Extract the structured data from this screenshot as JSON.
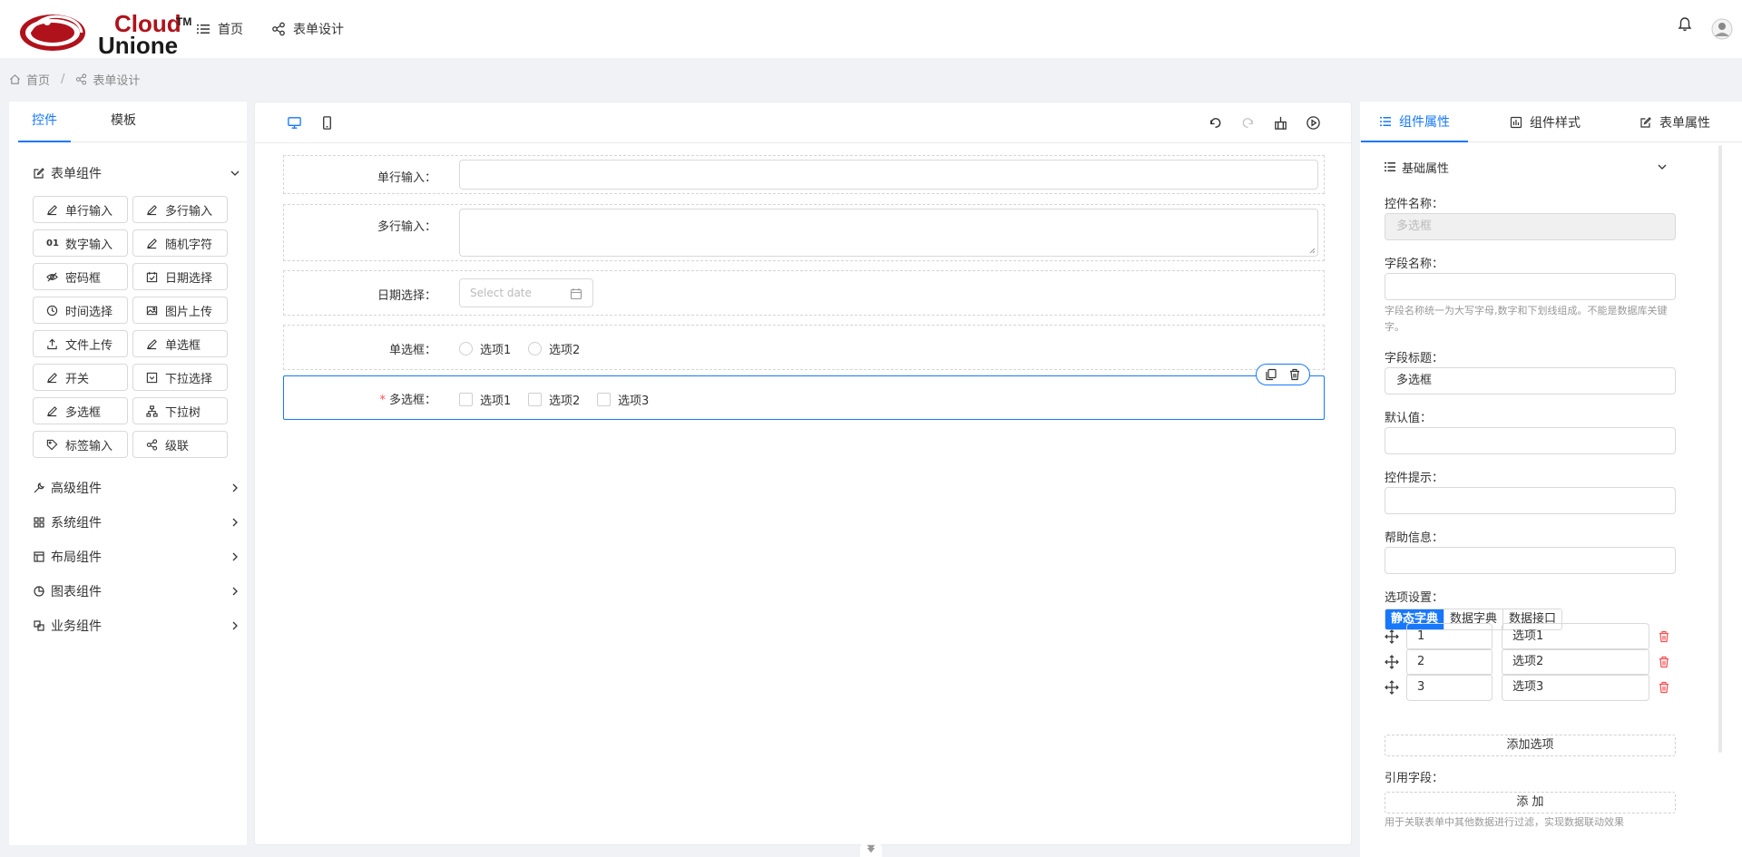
{
  "brand": {
    "line1": "Cloud",
    "line2": "Unione",
    "tm": "TM",
    "primary_color": "#b0121b"
  },
  "nav": {
    "home": "首页",
    "form_design": "表单设计"
  },
  "breadcrumb": {
    "home": "首页",
    "separator": "/",
    "current": "表单设计"
  },
  "left_panel": {
    "tabs": [
      "控件",
      "模板"
    ],
    "active_tab": "控件",
    "form_group": "表单组件",
    "components": [
      {
        "label": "单行输入",
        "icon": "pen-icon"
      },
      {
        "label": "多行输入",
        "icon": "pen-icon"
      },
      {
        "label": "数字输入",
        "icon": "number-icon",
        "glyph": "01"
      },
      {
        "label": "随机字符",
        "icon": "pen-icon"
      },
      {
        "label": "密码框",
        "icon": "eye-off-icon"
      },
      {
        "label": "日期选择",
        "icon": "calendar-check-icon"
      },
      {
        "label": "时间选择",
        "icon": "clock-icon"
      },
      {
        "label": "图片上传",
        "icon": "image-icon"
      },
      {
        "label": "文件上传",
        "icon": "upload-icon"
      },
      {
        "label": "单选框",
        "icon": "pen-icon"
      },
      {
        "label": "开关",
        "icon": "pen-icon"
      },
      {
        "label": "下拉选择",
        "icon": "select-icon"
      },
      {
        "label": "多选框",
        "icon": "pen-icon"
      },
      {
        "label": "下拉树",
        "icon": "tree-icon"
      },
      {
        "label": "标签输入",
        "icon": "tag-icon"
      },
      {
        "label": "级联",
        "icon": "cascade-icon"
      }
    ],
    "groups": [
      "高级组件",
      "系统组件",
      "布局组件",
      "图表组件",
      "业务组件"
    ]
  },
  "canvas": {
    "fields": {
      "single_line": {
        "label": "单行输入："
      },
      "multi_line": {
        "label": "多行输入："
      },
      "date": {
        "label": "日期选择：",
        "placeholder": "Select date"
      },
      "radio": {
        "label": "单选框：",
        "options": [
          "选项1",
          "选项2"
        ]
      },
      "checkbox": {
        "label": "多选框：",
        "required_mark": "*",
        "options": [
          "选项1",
          "选项2",
          "选项3"
        ]
      }
    }
  },
  "right_panel": {
    "tabs": [
      "组件属性",
      "组件样式",
      "表单属性"
    ],
    "active_tab": "组件属性",
    "section": "基础属性",
    "props": {
      "control_name_label": "控件名称：",
      "control_name_value": "多选框",
      "field_name_label": "字段名称：",
      "field_name_value": "",
      "field_name_help": "字段名称统一为大写字母,数字和下划线组成。不能是数据库关键字。",
      "field_title_label": "字段标题：",
      "field_title_value": "多选框",
      "default_label": "默认值：",
      "hint_label": "控件提示：",
      "help_label": "帮助信息："
    },
    "options_setting": {
      "label": "选项设置：",
      "modes": [
        "静态字典",
        "数据字典",
        "数据接口"
      ],
      "active_mode": "静态字典",
      "rows": [
        {
          "key": "1",
          "value": "选项1"
        },
        {
          "key": "2",
          "value": "选项2"
        },
        {
          "key": "3",
          "value": "选项3"
        }
      ],
      "add_label": "添加选项"
    },
    "ref_field": {
      "label": "引用字段：",
      "add_label": "添 加",
      "help": "用于关联表单中其他数据进行过滤，实现数据联动效果"
    }
  },
  "colors": {
    "accent": "#1677ff",
    "danger": "#ff4d4f",
    "border": "#d9d9d9"
  }
}
